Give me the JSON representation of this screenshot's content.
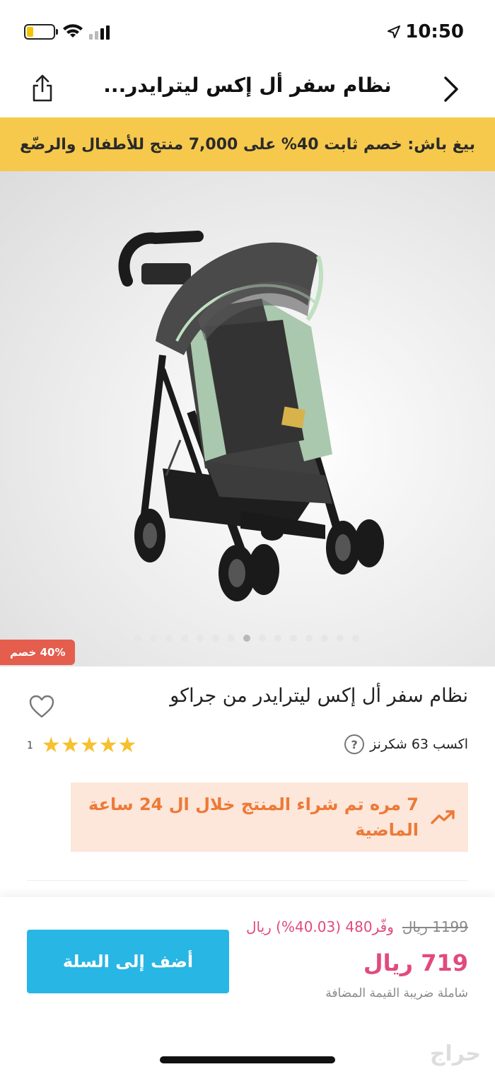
{
  "status_bar": {
    "time": "10:50",
    "battery_level": 0.2,
    "colors": {
      "battery": "#f4c400"
    }
  },
  "nav": {
    "title": "نظام سفر أل إكس ليترايدر...",
    "back_icon": "chevron-right-icon",
    "share_icon": "share-icon"
  },
  "promo_banner": {
    "text": "بيغ باش: خصم ثابت 40% على 7,000 منتج للأطفال والرضّع",
    "background": "#f6c94c"
  },
  "gallery": {
    "image_count": 15,
    "active_index": 7,
    "discount_badge": "40% خصم"
  },
  "product": {
    "title": "نظام سفر أل إكس ليترايدر من جراكو",
    "points": "اكسب 63 شكرنز",
    "points_help": "?",
    "rating": 5,
    "review_count": "1",
    "trending_text": "7 مره تم شراء المنتج خلال ال 24 ساعة الماضية"
  },
  "pricing": {
    "old_price": "1199 ريال",
    "save_text": "وفّر480 (40.03%) ريال",
    "current_price": "719 ريال",
    "vat_note": "شاملة ضريبة القيمة المضافة",
    "add_to_cart": "أضف إلى السلة",
    "colors": {
      "price": "#e24a7c",
      "button": "#28b6e4"
    }
  },
  "watermark": "حراج"
}
